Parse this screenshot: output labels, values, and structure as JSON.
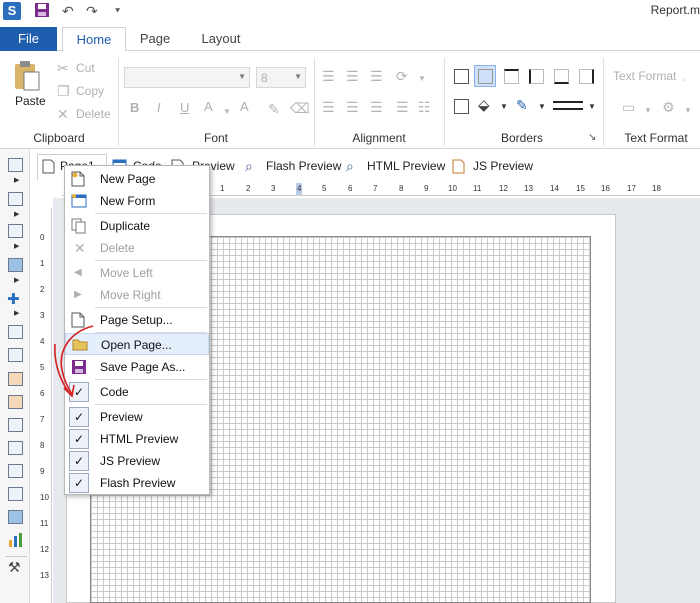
{
  "window": {
    "title": "Report.m",
    "logo": "S"
  },
  "qat": {
    "save_icon": "save-icon",
    "undo": "↶",
    "redo": "↷",
    "customize": "⯆"
  },
  "tabs": {
    "file": "File",
    "home": "Home",
    "page": "Page",
    "layout": "Layout"
  },
  "ribbon": {
    "clipboard": {
      "paste": "Paste",
      "cut": "Cut",
      "copy": "Copy",
      "delete": "Delete",
      "label": "Clipboard"
    },
    "font": {
      "label": "Font",
      "font_size": "8",
      "bold": "B",
      "italic": "I",
      "underline": "U",
      "font_color": "A",
      "grow": "A"
    },
    "alignment": {
      "label": "Alignment"
    },
    "borders": {
      "label": "Borders",
      "launcher": "↘"
    },
    "text_format": {
      "label": "Text Format",
      "title": "Text Format"
    }
  },
  "page_tabs": {
    "page1": "Page1",
    "code": "Code",
    "preview": "Preview",
    "flash": "Flash Preview",
    "html": "HTML Preview",
    "js": "JS Preview"
  },
  "ruler": {
    "h": [
      "1",
      "2",
      "3",
      "4",
      "5",
      "6",
      "7",
      "8",
      "9",
      "10",
      "11",
      "12",
      "13",
      "14",
      "15",
      "16",
      "17",
      "18"
    ],
    "v": [
      "0",
      "1",
      "2",
      "3",
      "4",
      "5",
      "6",
      "7",
      "8",
      "9",
      "10",
      "11",
      "12",
      "13"
    ]
  },
  "menu": {
    "new_page": "New Page",
    "new_form": "New Form",
    "duplicate": "Duplicate",
    "delete": "Delete",
    "move_left": "Move Left",
    "move_right": "Move Right",
    "page_setup": "Page Setup...",
    "open_page": "Open Page...",
    "save_page_as": "Save Page As...",
    "code": "Code",
    "preview": "Preview",
    "html_preview": "HTML Preview",
    "js_preview": "JS Preview",
    "flash_preview": "Flash Preview",
    "check": "✓"
  },
  "colors": {
    "accent": "#1f5eae",
    "annotation": "#d42020"
  }
}
